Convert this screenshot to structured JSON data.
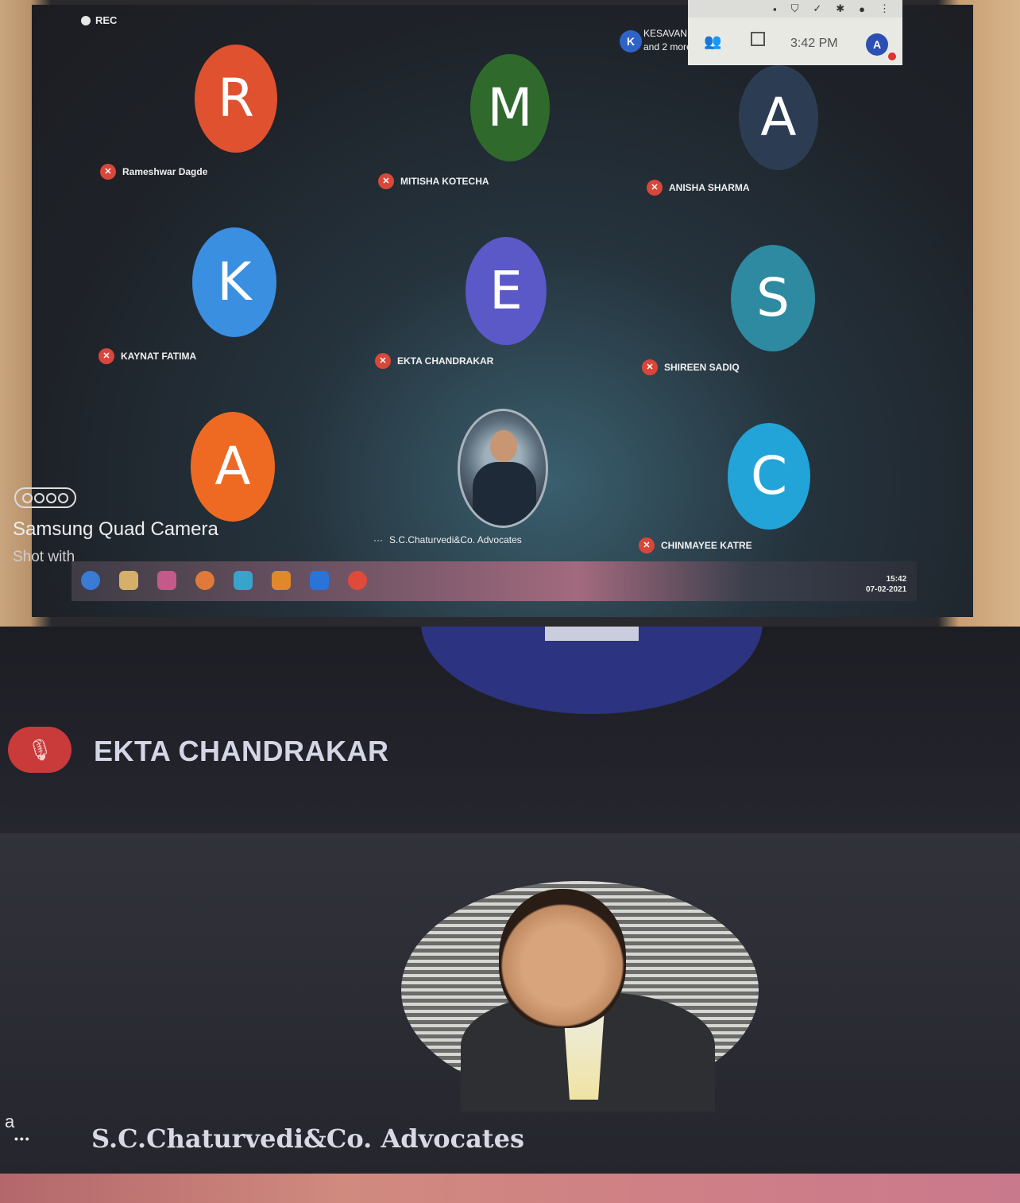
{
  "top_screen": {
    "rec_label": "REC",
    "host": {
      "initial": "K",
      "line1": "KESAVAN R",
      "line2": "and 2 more"
    },
    "time": "3:42 PM",
    "my_avatar_initial": "A",
    "tiles": [
      {
        "initial": "R",
        "name": "Rameshwar Dagde",
        "color": "#e0512f"
      },
      {
        "initial": "M",
        "name": "MITISHA KOTECHA",
        "color": "#2f6a2c"
      },
      {
        "initial": "A",
        "name": "ANISHA SHARMA",
        "color": "#2c3d53"
      },
      {
        "initial": "K",
        "name": "KAYNAT FATIMA",
        "color": "#3a8fe0"
      },
      {
        "initial": "E",
        "name": "EKTA CHANDRAKAR",
        "color": "#5b58c8"
      },
      {
        "initial": "S",
        "name": "SHIREEN SADIQ",
        "color": "#2d8aa0"
      },
      {
        "initial": "A",
        "name": "",
        "color": "#ee6a23"
      },
      {
        "initial": "",
        "name": "S.C.Chaturvedi&Co. Advocates",
        "color": "#8a9aa6"
      },
      {
        "initial": "C",
        "name": "CHINMAYEE KATRE",
        "color": "#22a4d8"
      }
    ],
    "watermark": {
      "title": "Samsung Quad Camera",
      "subtitle": "Shot with"
    },
    "tray": {
      "time": "15:42",
      "date": "07-02-2021"
    }
  },
  "bottom_screen": {
    "speaker_name": "EKTA CHANDRAKAR",
    "presenter_name": "S.C.Chaturvedi&Co. Advocates",
    "side_letter": "a"
  },
  "colors": {
    "mute_red": "#d9473a",
    "screen_bg": "#1e2228"
  }
}
